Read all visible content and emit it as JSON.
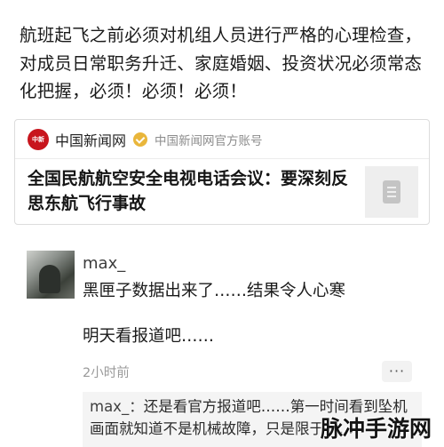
{
  "post": {
    "text": "航班起飞之前必须对机组人员进行严格的心理检查，对成员日常职务升迁、家庭婚姻、投资状况必须常态化把握，必须！必须！必须！"
  },
  "share_card": {
    "source_logo_text": "中国新闻网",
    "source_name": "中国新闻网",
    "source_desc": "中国新闻网官方账号",
    "title": "全国民航航空安全电视电话会议：要深刻反思东航飞行事故",
    "thumb_icon": "document-icon"
  },
  "comment": {
    "username": "max_",
    "line1": "黑匣子数据出来了……结果令人心寒",
    "line2": "明天看报道吧……",
    "time": "2小时前",
    "more": "···",
    "reply_author": "max_：",
    "reply_text": "还是看官方报道吧……第一时间看到坠机画面就知道不是机械故障，只是限于……"
  },
  "watermark": "脉冲手游网",
  "colors": {
    "logo_red": "#c8151d",
    "verified_gold": "#e9b63b",
    "muted_text": "#9a9a9a"
  }
}
